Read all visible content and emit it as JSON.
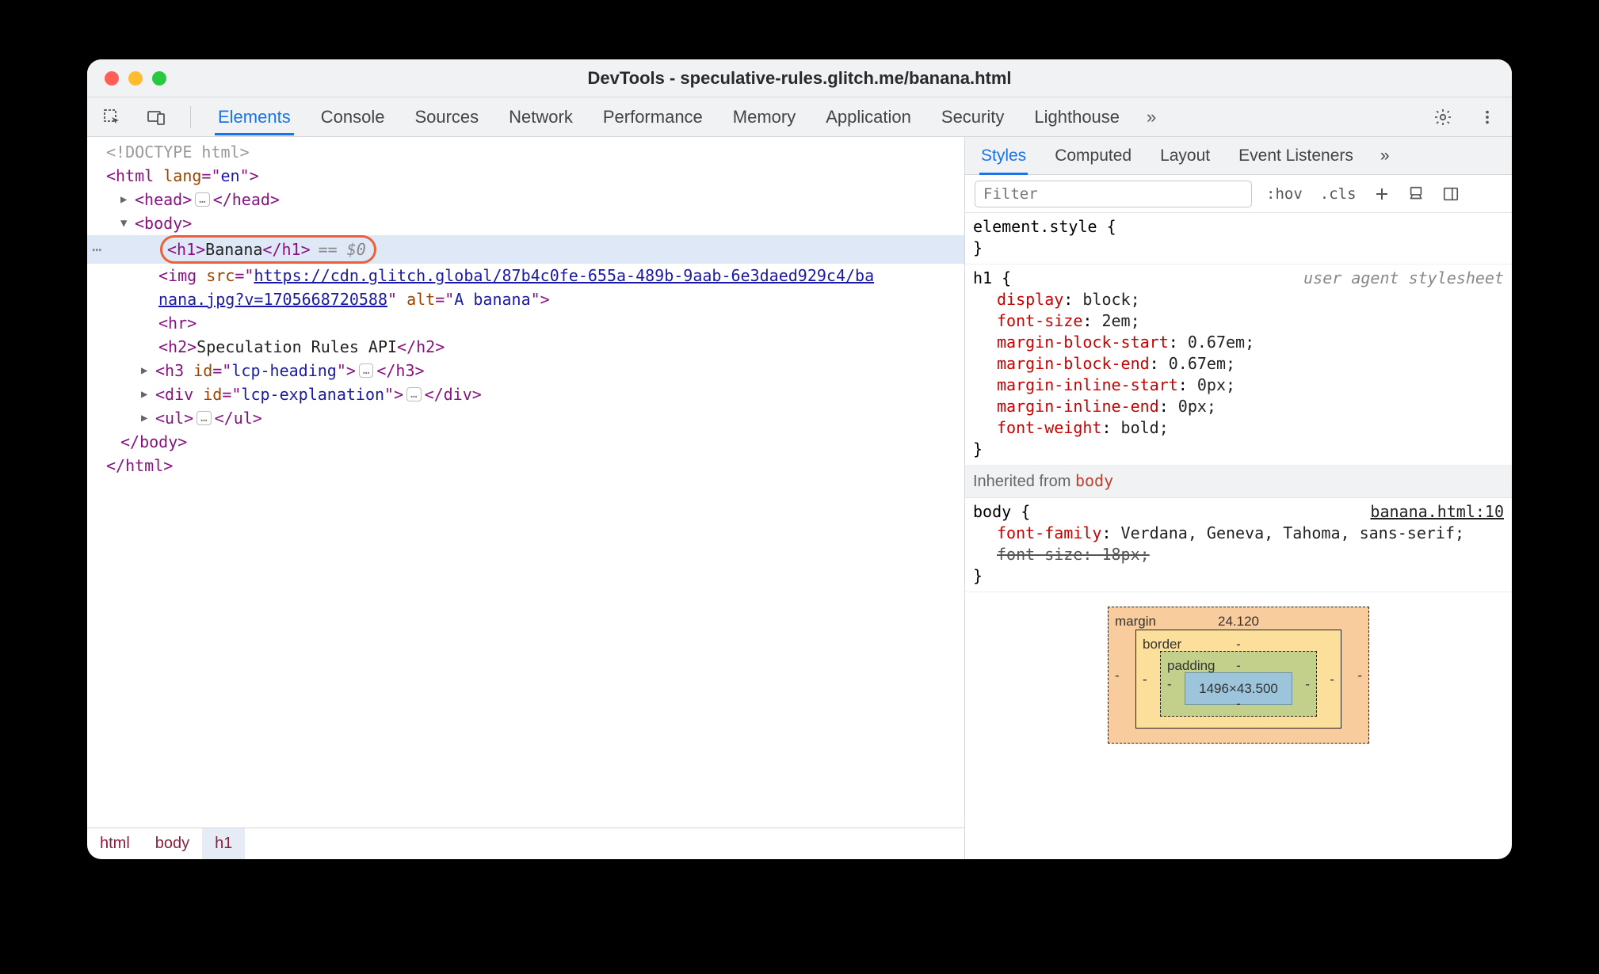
{
  "window": {
    "title": "DevTools - speculative-rules.glitch.me/banana.html"
  },
  "tabs": {
    "items": [
      "Elements",
      "Console",
      "Sources",
      "Network",
      "Performance",
      "Memory",
      "Application",
      "Security",
      "Lighthouse"
    ],
    "more": "»"
  },
  "dom": {
    "doctype": "<!DOCTYPE html>",
    "html_open": "<html lang=\"en\">",
    "head_open": "<head>",
    "head_close": "</head>",
    "body_open": "<body>",
    "h1_open": "<h1>",
    "h1_text": "Banana",
    "h1_close": "</h1>",
    "sel_suffix": "== $0",
    "img_prefix": "<img src=\"",
    "img_url_line1": "https://cdn.glitch.global/87b4c0fe-655a-489b-9aab-6e3daed929c4/ba",
    "img_url_line2": "nana.jpg?v=1705668720588",
    "img_suffix": "\" alt=\"A banana\">",
    "hr": "<hr>",
    "h2_open": "<h2>",
    "h2_text": "Speculation Rules API",
    "h2_close": "</h2>",
    "h3": "<h3 id=\"lcp-heading\">",
    "h3_close": "</h3>",
    "div": "<div id=\"lcp-explanation\">",
    "div_close": "</div>",
    "ul": "<ul>",
    "ul_close": "</ul>",
    "body_close": "</body>",
    "html_close": "</html>",
    "ellipsis": "…"
  },
  "crumbs": [
    "html",
    "body",
    "h1"
  ],
  "rtabs": {
    "items": [
      "Styles",
      "Computed",
      "Layout",
      "Event Listeners"
    ],
    "more": "»"
  },
  "filter": {
    "placeholder": "Filter",
    "hov": ":hov",
    "cls": ".cls"
  },
  "styles": {
    "elem_selector": "element.style {",
    "close": "}",
    "h1_selector": "h1 {",
    "h1_src": "user agent stylesheet",
    "h1_props": [
      {
        "n": "display",
        "v": "block;"
      },
      {
        "n": "font-size",
        "v": "2em;"
      },
      {
        "n": "margin-block-start",
        "v": "0.67em;"
      },
      {
        "n": "margin-block-end",
        "v": "0.67em;"
      },
      {
        "n": "margin-inline-start",
        "v": "0px;"
      },
      {
        "n": "margin-inline-end",
        "v": "0px;"
      },
      {
        "n": "font-weight",
        "v": "bold;"
      }
    ],
    "inherited_label": "Inherited from ",
    "inherited_from": "body",
    "body_selector": "body {",
    "body_src": "banana.html:10",
    "body_props": [
      {
        "n": "font-family",
        "v": "Verdana, Geneva, Tahoma, sans-serif;",
        "strike": false
      },
      {
        "n": "font-size",
        "v": "18px;",
        "strike": true
      }
    ]
  },
  "boxmodel": {
    "margin_label": "margin",
    "margin_top": "24.120",
    "border_label": "border",
    "padding_label": "padding",
    "content": "1496×43.500",
    "dash": "-"
  }
}
